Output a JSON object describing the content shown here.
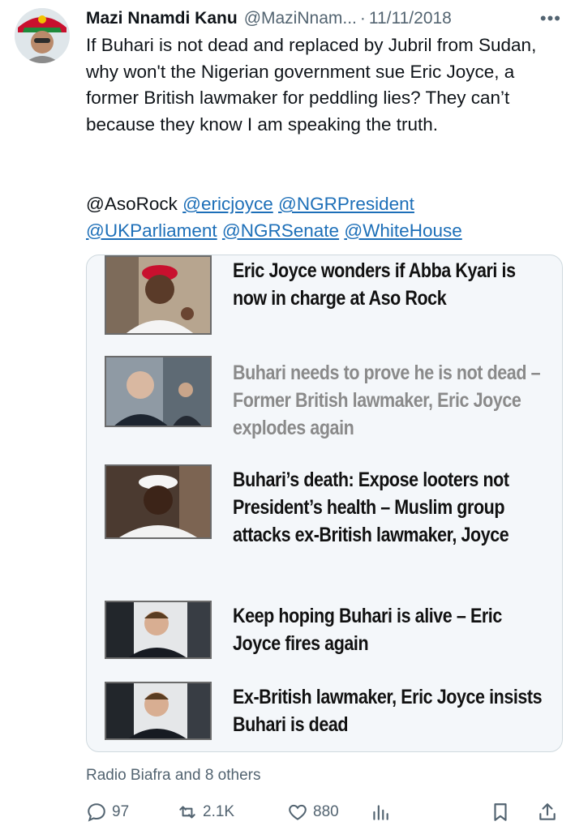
{
  "tweet": {
    "author_name": "Mazi Nnamdi Kanu",
    "handle": "@MaziNnam...",
    "separator": "·",
    "date": "11/11/2018",
    "more_icon": "•••",
    "text": "If Buhari is not dead and replaced by Jubril from Sudan, why won't the Nigerian government sue Eric Joyce, a former British lawmaker for peddling lies? They can’t because they know I am speaking the truth.",
    "mentions": [
      {
        "text": "@AsoRock",
        "link": false
      },
      {
        "text": "@ericjoyce",
        "link": true
      },
      {
        "text": "@NGRPresident",
        "link": true
      },
      {
        "text": "@UKParliament",
        "link": true
      },
      {
        "text": "@NGRSenate",
        "link": true
      },
      {
        "text": "@WhiteHouse",
        "link": true
      }
    ]
  },
  "media": {
    "items": [
      {
        "headline": "Eric Joyce wonders if Abba Kyari is now in charge at Aso Rock",
        "faded": false
      },
      {
        "headline": "Buhari needs to prove he is not dead – Former British lawmaker, Eric Joyce explodes again",
        "faded": true
      },
      {
        "headline": "Buhari’s death: Expose looters not President’s health – Muslim group attacks ex-British lawmaker, Joyce",
        "faded": false
      },
      {
        "headline": "Keep hoping Buhari is alive – Eric Joyce fires again",
        "faded": false
      },
      {
        "headline": "Ex-British lawmaker, Eric Joyce insists Buhari is dead",
        "faded": false
      }
    ]
  },
  "social_context": "Radio Biafra and 8 others",
  "actions": {
    "replies": "97",
    "reposts": "2.1K",
    "likes": "880"
  },
  "icons": [
    "reply-icon",
    "repost-icon",
    "like-icon",
    "views-icon",
    "bookmark-icon",
    "share-icon"
  ],
  "colors": {
    "link": "#1d6fb8",
    "muted": "#536471",
    "text": "#0f1419"
  }
}
